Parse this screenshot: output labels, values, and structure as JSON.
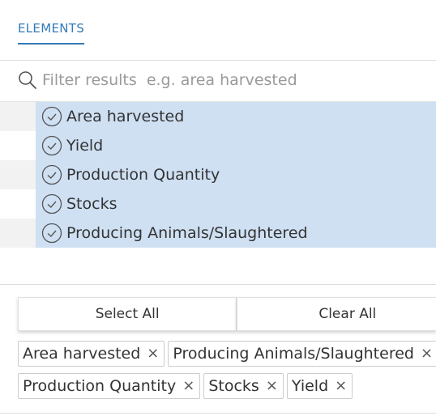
{
  "tab": {
    "label": "ELEMENTS"
  },
  "search": {
    "placeholder": "Filter results  e.g. area harvested"
  },
  "elements": [
    {
      "label": "Area harvested",
      "selected": true
    },
    {
      "label": "Yield",
      "selected": true
    },
    {
      "label": "Production Quantity",
      "selected": true
    },
    {
      "label": "Stocks",
      "selected": true
    },
    {
      "label": "Producing Animals/Slaughtered",
      "selected": true
    }
  ],
  "buttons": {
    "select_all": "Select All",
    "clear_all": "Clear All"
  },
  "chips": [
    {
      "label": "Area harvested",
      "remove": "×"
    },
    {
      "label": "Producing Animals/Slaughtered",
      "remove": "×"
    },
    {
      "label": "Production Quantity",
      "remove": "×"
    },
    {
      "label": "Stocks",
      "remove": "×"
    },
    {
      "label": "Yield",
      "remove": "×"
    }
  ],
  "colors": {
    "accent": "#337ab7",
    "selected_bg": "#cfe0f3",
    "stripe": "#f2f2f2"
  }
}
